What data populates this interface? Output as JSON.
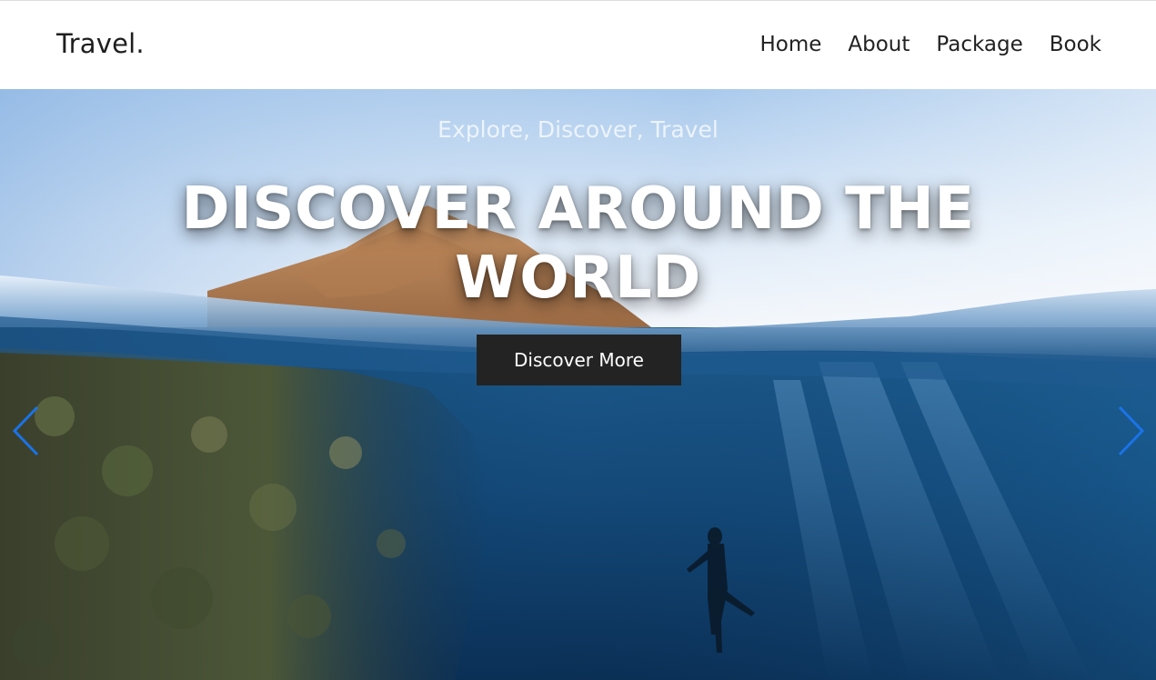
{
  "navbar": {
    "brand": "Travel.",
    "links": [
      {
        "label": "Home"
      },
      {
        "label": "About"
      },
      {
        "label": "Package"
      },
      {
        "label": "Book"
      }
    ]
  },
  "hero": {
    "subtitle": "Explore, Discover, Travel",
    "title": "DISCOVER AROUND THE WORLD",
    "cta_label": "Discover More",
    "prev_icon": "chevron-left-icon",
    "next_icon": "chevron-right-icon",
    "arrow_color": "#1a73e8"
  }
}
